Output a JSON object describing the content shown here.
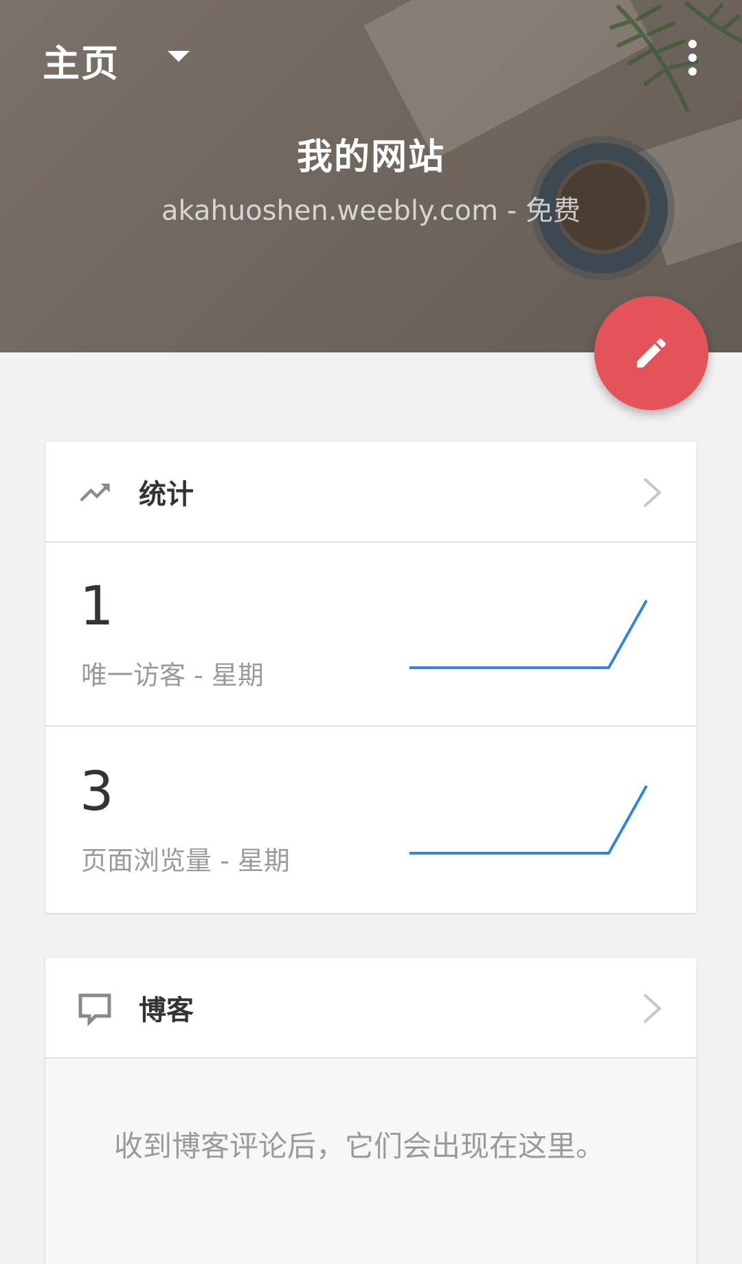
{
  "nav": {
    "title": "主页",
    "dropdown_icon": "caret-down-icon",
    "menu_icon": "more-vert-icon"
  },
  "site": {
    "title": "我的网站",
    "url_line": "akahuoshen.weebly.com - 免费"
  },
  "fab": {
    "icon": "pencil-icon",
    "color": "#e5535a"
  },
  "stats_card": {
    "title": "统计",
    "icon": "trending-up-icon",
    "chevron_icon": "chevron-right-icon",
    "rows": [
      {
        "value": "1",
        "label": "唯一访客 - 星期",
        "trend": [
          0,
          0,
          0,
          0,
          0,
          0,
          1
        ]
      },
      {
        "value": "3",
        "label": "页面浏览量 - 星期",
        "trend": [
          0,
          0,
          0,
          0,
          0,
          0,
          3
        ]
      }
    ],
    "line_color": "#2f86d6"
  },
  "blog_card": {
    "title": "博客",
    "icon": "comment-icon",
    "chevron_icon": "chevron-right-icon",
    "empty_text": "收到博客评论后，它们会出现在这里。"
  }
}
